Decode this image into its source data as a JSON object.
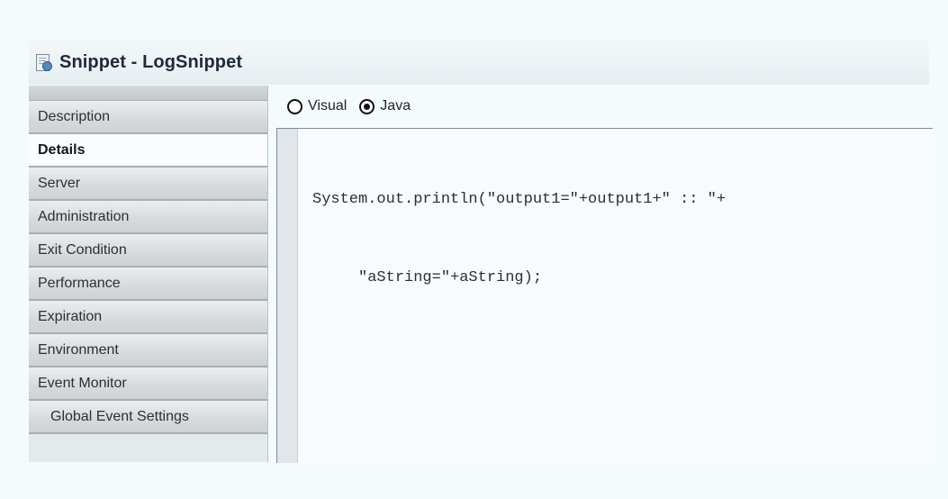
{
  "title": {
    "text": "Snippet - LogSnippet",
    "icon": "snippet-icon"
  },
  "sidebar": {
    "items": [
      {
        "label": "Description"
      },
      {
        "label": "Details",
        "active": true
      },
      {
        "label": "Server"
      },
      {
        "label": "Administration"
      },
      {
        "label": "Exit Condition"
      },
      {
        "label": "Performance"
      },
      {
        "label": "Expiration"
      },
      {
        "label": "Environment"
      },
      {
        "label": "Event Monitor"
      },
      {
        "label": "Global Event Settings"
      }
    ]
  },
  "mode": {
    "options": [
      {
        "label": "Visual",
        "selected": false
      },
      {
        "label": "Java",
        "selected": true
      }
    ]
  },
  "editor": {
    "lines": [
      "System.out.println(\"output1=\"+output1+\" :: \"+",
      "     \"aString=\"+aString);"
    ]
  }
}
